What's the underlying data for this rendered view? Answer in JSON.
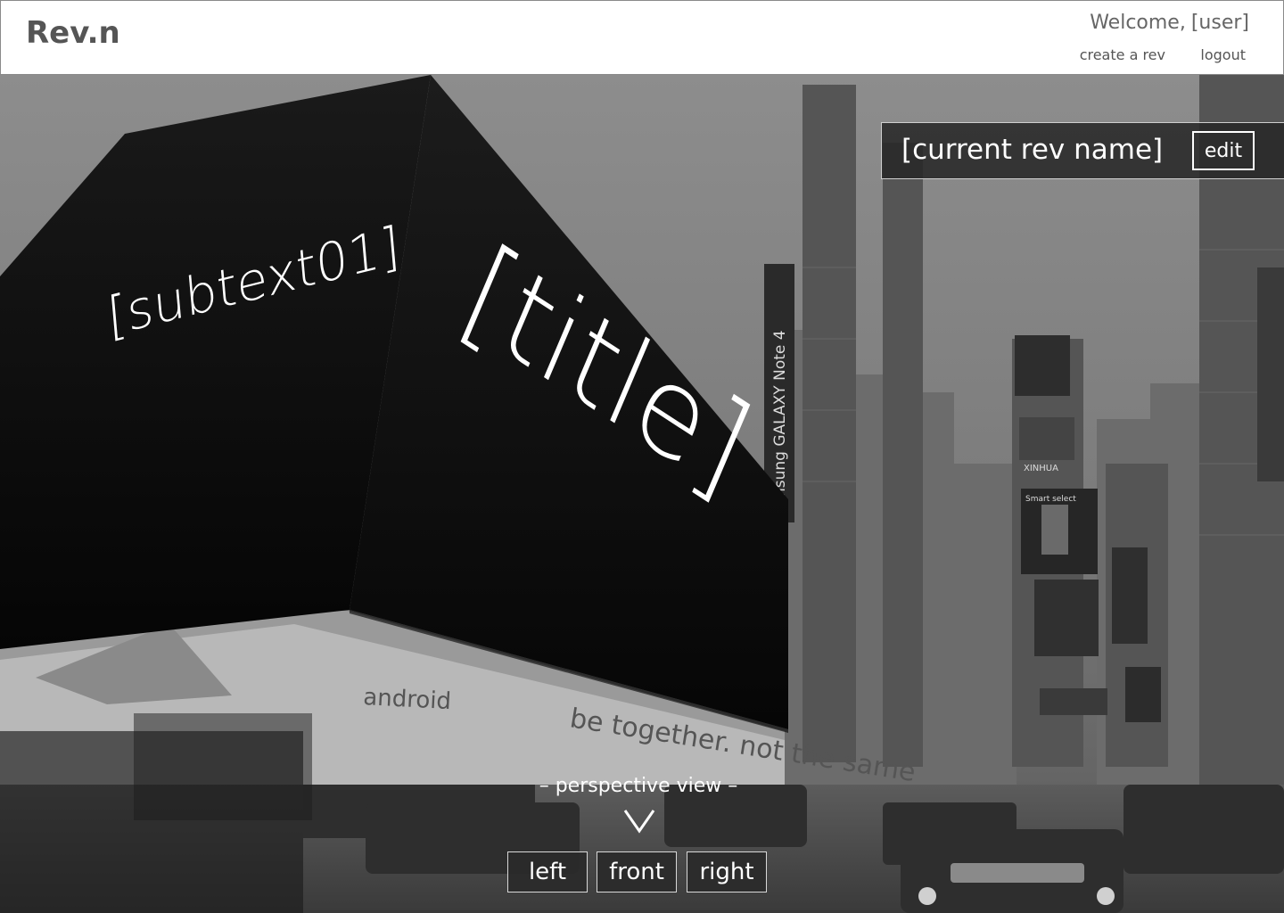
{
  "header": {
    "logo": "Rev.n",
    "welcome_text": "Welcome,",
    "welcome_user": "[user]",
    "create_link": "create a rev",
    "logout_link": "logout"
  },
  "rev_panel": {
    "name": "[current rev name]",
    "edit_label": "edit"
  },
  "billboard": {
    "subtext": "[subtext01]",
    "title": "[title]"
  },
  "background_signage": {
    "samsung_sign": "Samsung GALAXY Note 4",
    "android_sign": "android",
    "slogan": "be together. not the same",
    "xinhua_sign": "XINHUA",
    "smart_select": "Smart select"
  },
  "perspective": {
    "label": "– perspective view –",
    "buttons": {
      "left": "left",
      "front": "front",
      "right": "right"
    }
  },
  "colors": {
    "header_bg": "#ffffff",
    "logo": "#555555",
    "panel_bg": "#262626",
    "billboard": "#0a0a0a",
    "text_on_dark": "#ffffff"
  }
}
